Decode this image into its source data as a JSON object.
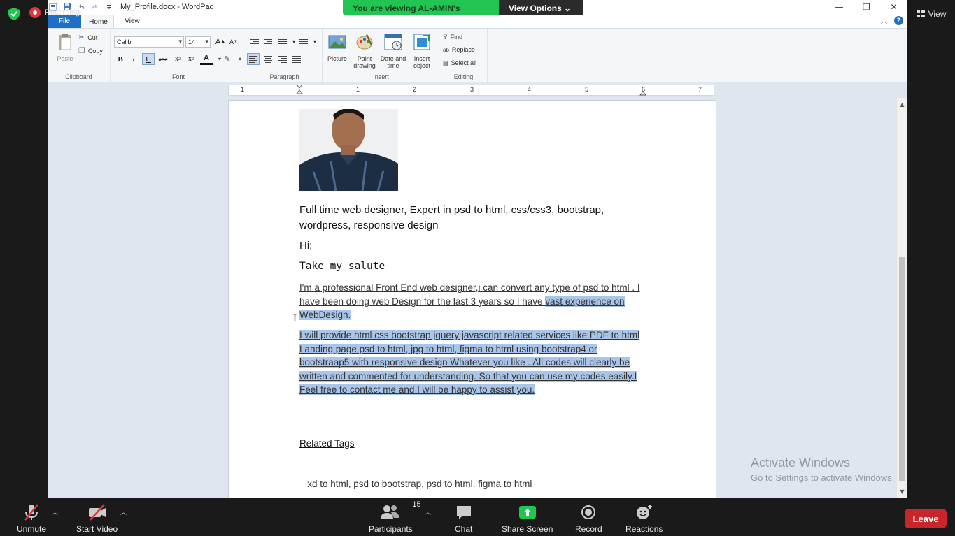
{
  "zoom": {
    "recording_label": "Recording",
    "view_label": "View",
    "banner_viewing": "You are viewing AL-AMIN's screen",
    "banner_options": "View Options",
    "toolbar": {
      "unmute": "Unmute",
      "start_video": "Start Video",
      "participants": "Participants",
      "participants_count": "15",
      "chat": "Chat",
      "share_screen": "Share Screen",
      "record": "Record",
      "reactions": "Reactions",
      "leave": "Leave"
    },
    "colors": {
      "share_green": "#23c552",
      "leave_red": "#c8262b"
    }
  },
  "wordpad": {
    "title": "My_Profile.docx - WordPad",
    "tabs": {
      "file": "File",
      "home": "Home",
      "view": "View"
    },
    "ribbon": {
      "clipboard": {
        "label": "Clipboard",
        "paste": "Paste",
        "cut": "Cut",
        "copy": "Copy"
      },
      "font": {
        "label": "Font",
        "family": "Calibri",
        "size": "14"
      },
      "paragraph": {
        "label": "Paragraph"
      },
      "insert": {
        "label": "Insert",
        "picture": "Picture",
        "paint_drawing": "Paint drawing",
        "date_time": "Date and time",
        "insert_object": "Insert object"
      },
      "editing": {
        "label": "Editing",
        "find": "Find",
        "replace": "Replace",
        "select_all": "Select all"
      }
    },
    "ruler_numbers": [
      "1",
      "1",
      "2",
      "3",
      "4",
      "5",
      "6",
      "7"
    ],
    "document": {
      "headline": "Full time web designer, Expert in psd to html, css/css3, bootstrap, wordpress, responsive design",
      "hi": "Hi;",
      "salute": "Take my salute",
      "para1_normal": "I'm a professional Front End web designer,i can convert any type of psd to html . I have been doing web Design for the last 3 years so I have ",
      "para1_highlight": "vast experience on WebDesign.",
      "para2": "I will provide html css bootstrap jquery javascript related services like PDF to html Landing page psd to html, jpg to html, figma to html using bootstrap4 or bootstraap5 with responsive design Whatever you like . All codes will clearly be written and commented for understanding. So that you can use my codes easily.I Feel free to contact me and I will be happy to assist you.",
      "related_tags": "Related Tags",
      "tags": "   xd to html, psd to bootstrap, psd to html, figma to html"
    }
  },
  "watermark": {
    "line1": "Activate Windows",
    "line2": "Go to Settings to activate Windows."
  }
}
